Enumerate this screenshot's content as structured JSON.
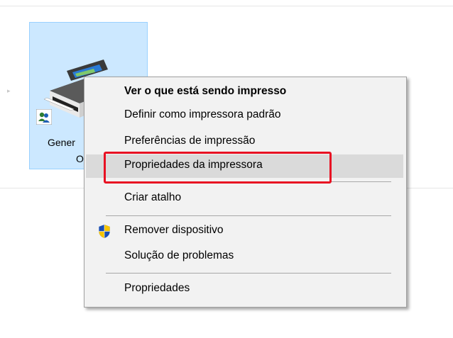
{
  "device": {
    "name_line1": "Gener",
    "name_line2": "O",
    "badge_icon": "users-icon",
    "printer_icon": "printer-icon"
  },
  "context_menu": {
    "items": [
      {
        "label": "Ver o que está sendo impresso",
        "bold": true
      },
      {
        "label": "Definir como impressora padrão"
      },
      {
        "label": "Preferências de impressão"
      },
      {
        "label": "Propriedades da impressora",
        "highlighted": true
      },
      {
        "label": "Criar atalho"
      },
      {
        "label": "Remover dispositivo",
        "icon": "uac-shield-icon"
      },
      {
        "label": "Solução de problemas"
      },
      {
        "label": "Propriedades"
      }
    ]
  },
  "colors": {
    "tile_selected_bg": "#cce8ff",
    "menu_bg": "#f2f2f2",
    "menu_hover": "#dadada",
    "annotation_red": "#e81123"
  }
}
